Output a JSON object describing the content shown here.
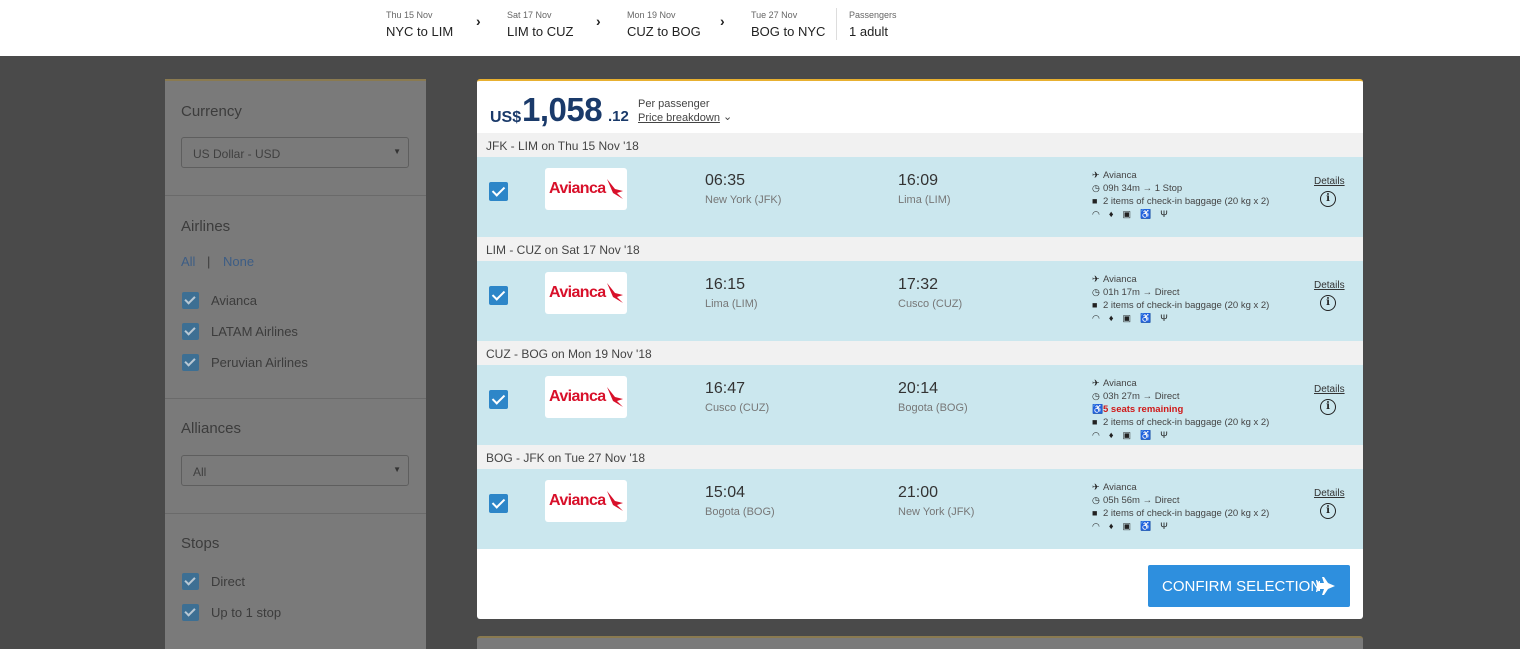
{
  "header": {
    "legs": [
      {
        "date": "Thu 15 Nov",
        "route": "NYC to LIM"
      },
      {
        "date": "Sat 17 Nov",
        "route": "LIM to CUZ"
      },
      {
        "date": "Mon 19 Nov",
        "route": "CUZ to BOG"
      },
      {
        "date": "Tue 27 Nov",
        "route": "BOG to NYC"
      }
    ],
    "passengers_label": "Passengers",
    "passengers_value": "1 adult"
  },
  "sidebar": {
    "currency": {
      "title": "Currency",
      "selected": "US Dollar - USD"
    },
    "airlines": {
      "title": "Airlines",
      "all_label": "All",
      "separator": "|",
      "none_label": "None",
      "items": [
        {
          "label": "Avianca",
          "checked": true
        },
        {
          "label": "LATAM Airlines",
          "checked": true
        },
        {
          "label": "Peruvian Airlines",
          "checked": true
        }
      ]
    },
    "alliances": {
      "title": "Alliances",
      "selected": "All"
    },
    "stops": {
      "title": "Stops",
      "items": [
        {
          "label": "Direct",
          "checked": true
        },
        {
          "label": "Up to 1 stop",
          "checked": true
        }
      ]
    }
  },
  "result": {
    "currency": "US$",
    "price_main": "1,058",
    "price_cents": ".12",
    "per_passenger": "Per passenger",
    "price_breakdown": "Price breakdown",
    "legs": [
      {
        "heading": "JFK - LIM on Thu 15 Nov '18",
        "airline": "Avianca",
        "dep_time": "06:35",
        "dep_place": "New York (JFK)",
        "arr_time": "16:09",
        "arr_place": "Lima (LIM)",
        "carrier": "Avianca",
        "duration": "09h 34m → 1 Stop",
        "seats": "",
        "baggage": "2 items of check-in baggage (20 kg x 2)",
        "details": "Details"
      },
      {
        "heading": "LIM - CUZ on Sat 17 Nov '18",
        "airline": "Avianca",
        "dep_time": "16:15",
        "dep_place": "Lima (LIM)",
        "arr_time": "17:32",
        "arr_place": "Cusco (CUZ)",
        "carrier": "Avianca",
        "duration": "01h 17m → Direct",
        "seats": "",
        "baggage": "2 items of check-in baggage (20 kg x 2)",
        "details": "Details"
      },
      {
        "heading": "CUZ - BOG on Mon 19 Nov '18",
        "airline": "Avianca",
        "dep_time": "16:47",
        "dep_place": "Cusco (CUZ)",
        "arr_time": "20:14",
        "arr_place": "Bogota (BOG)",
        "carrier": "Avianca",
        "duration": "03h 27m → Direct",
        "seats": "5 seats remaining",
        "baggage": "2 items of check-in baggage (20 kg x 2)",
        "details": "Details"
      },
      {
        "heading": "BOG - JFK on Tue 27 Nov '18",
        "airline": "Avianca",
        "dep_time": "15:04",
        "dep_place": "Bogota (BOG)",
        "arr_time": "21:00",
        "arr_place": "New York (JFK)",
        "carrier": "Avianca",
        "duration": "05h 56m → Direct",
        "seats": "",
        "baggage": "2 items of check-in baggage (20 kg x 2)",
        "details": "Details"
      }
    ],
    "confirm_label": "CONFIRM SELECTION"
  },
  "colors": {
    "brand_red": "#d8102a",
    "primary_blue": "#2e8fde",
    "price_navy": "#1a3a6a",
    "leg_bg": "#cbe7ee",
    "warning_red": "#d01818"
  },
  "icons": [
    "chevron-right-icon",
    "dropdown-arrow-icon",
    "checkbox-checked-icon",
    "plane-icon",
    "clock-icon",
    "baggage-icon",
    "seat-icon",
    "wifi-icon",
    "power-icon",
    "screen-icon",
    "seat-recline-icon",
    "meal-icon",
    "info-icon"
  ]
}
